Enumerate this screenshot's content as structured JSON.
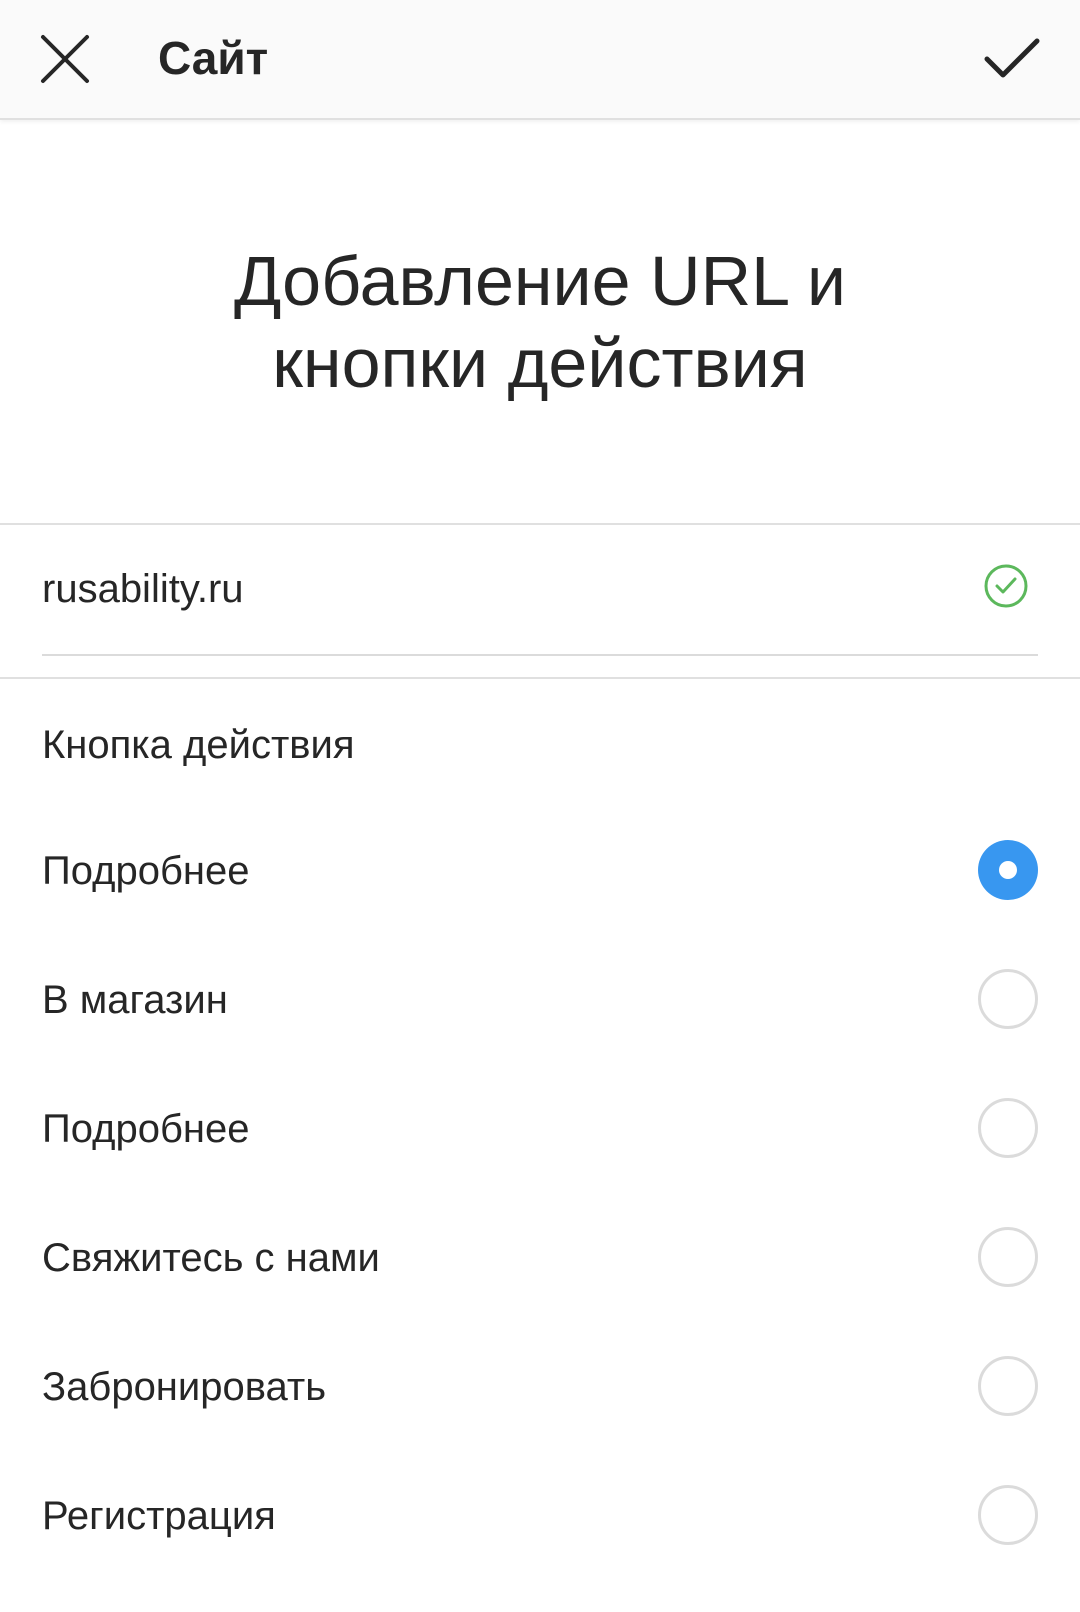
{
  "header": {
    "title": "Сайт",
    "close_icon": "close-icon",
    "done_icon": "checkmark-icon"
  },
  "headline": {
    "line1": "Добавление URL и",
    "line2": "кнопки действия"
  },
  "url_field": {
    "value": "rusability.ru",
    "status_icon": "valid-check-icon",
    "status_color": "#5cb85c"
  },
  "action_section": {
    "label": "Кнопка действия",
    "options": [
      {
        "label": "Подробнее",
        "selected": true
      },
      {
        "label": "В магазин",
        "selected": false
      },
      {
        "label": "Подробнее",
        "selected": false
      },
      {
        "label": "Свяжитесь с нами",
        "selected": false
      },
      {
        "label": "Забронировать",
        "selected": false
      },
      {
        "label": "Регистрация",
        "selected": false
      }
    ]
  },
  "colors": {
    "accent": "#3897f0",
    "valid": "#5cb85c",
    "text": "#262626",
    "divider": "#e0e0e0"
  }
}
